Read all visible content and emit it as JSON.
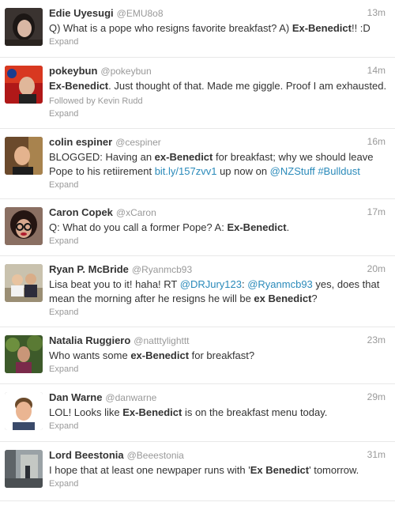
{
  "colors": {
    "name": "#333333",
    "meta": "#999999",
    "link": "#2a8aba",
    "divider": "#e8e8e8"
  },
  "expand_label": "Expand",
  "tweets": [
    {
      "name": "Edie Uyesugi",
      "handle": "@EMU8o8",
      "time": "13m",
      "avatar_icon": "avatar-dark-hair-photo",
      "parts": [
        {
          "t": "Q) What is a pope who resigns favorite breakfast? A) "
        },
        {
          "t": "Ex-Benedict",
          "b": true
        },
        {
          "t": "!! :D"
        }
      ]
    },
    {
      "name": "pokeybun",
      "handle": "@pokeybun",
      "time": "14m",
      "avatar_icon": "avatar-nasa-photo",
      "followed_by": "Followed by Kevin Rudd",
      "parts": [
        {
          "t": "Ex-Benedict",
          "b": true
        },
        {
          "t": ". Just thought of that. Made me giggle. Proof I am exhausted."
        }
      ]
    },
    {
      "name": "colin espiner",
      "handle": "@cespiner",
      "time": "16m",
      "avatar_icon": "avatar-man-photo",
      "parts": [
        {
          "t": "BLOGGED: Having an "
        },
        {
          "t": "ex-Benedict",
          "b": true
        },
        {
          "t": " for breakfast; why we should leave Pope to his retiirement "
        },
        {
          "t": "bit.ly/157zvv1",
          "link": true
        },
        {
          "t": " up now on "
        },
        {
          "t": "@NZStuff",
          "link": true
        },
        {
          "t": " "
        },
        {
          "t": "#Bulldust",
          "link": true
        }
      ]
    },
    {
      "name": "Caron Copek",
      "handle": "@xCaron",
      "time": "17m",
      "avatar_icon": "avatar-glasses-photo",
      "parts": [
        {
          "t": "Q: What do you call a former Pope? A: "
        },
        {
          "t": "Ex-Benedict",
          "b": true
        },
        {
          "t": "."
        }
      ]
    },
    {
      "name": "Ryan P. McBride",
      "handle": "@Ryanmcb93",
      "time": "20m",
      "avatar_icon": "avatar-group-photo",
      "parts": [
        {
          "t": "Lisa beat you to it! haha! RT "
        },
        {
          "t": "@DRJury123",
          "link": true
        },
        {
          "t": ": "
        },
        {
          "t": "@Ryanmcb93",
          "link": true
        },
        {
          "t": " yes, does that mean the morning after he resigns he will be "
        },
        {
          "t": "ex Benedict",
          "b": true
        },
        {
          "t": "?"
        }
      ]
    },
    {
      "name": "Natalia Ruggiero",
      "handle": "@natttylighttt",
      "time": "23m",
      "avatar_icon": "avatar-outdoor-photo",
      "parts": [
        {
          "t": "Who wants some "
        },
        {
          "t": "ex-Benedict",
          "b": true
        },
        {
          "t": " for breakfast?"
        }
      ]
    },
    {
      "name": "Dan Warne",
      "handle": "@danwarne",
      "time": "29m",
      "avatar_icon": "avatar-smiling-man-photo",
      "parts": [
        {
          "t": "LOL! Looks like "
        },
        {
          "t": "Ex-Benedict",
          "b": true
        },
        {
          "t": " is on the breakfast menu today."
        }
      ]
    },
    {
      "name": "Lord Beestonia",
      "handle": "@Beeestonia",
      "time": "31m",
      "avatar_icon": "avatar-street-photo",
      "parts": [
        {
          "t": "I hope that at least one newpaper runs with '"
        },
        {
          "t": "Ex Benedict",
          "b": true
        },
        {
          "t": "' tomorrow."
        }
      ]
    }
  ]
}
